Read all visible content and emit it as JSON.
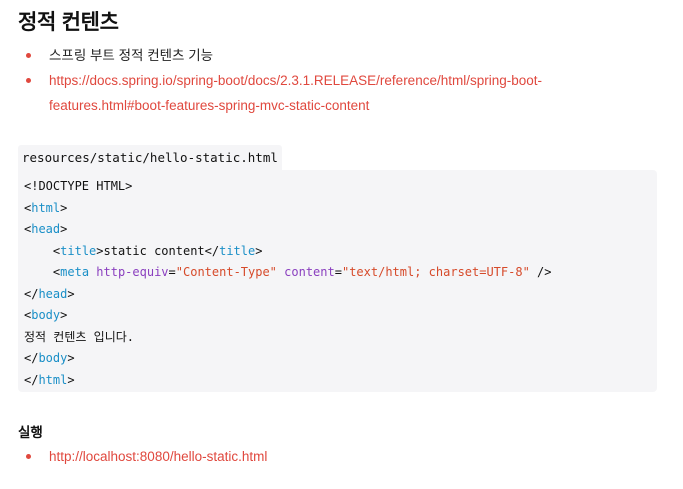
{
  "title": "정적 컨텐츠",
  "intro": {
    "bullet1": "스프링 부트 정적 컨텐츠 기능",
    "link_line1": "https://docs.spring.io/spring-boot/docs/2.3.1.RELEASE/reference/html/spring-boot-",
    "link_line2": "features.html#boot-features-spring-mvc-static-content"
  },
  "code": {
    "filename": "resources/static/hello-static.html",
    "doctype": "<!DOCTYPE HTML>",
    "lt": "<",
    "lt_close": "</",
    "gt": ">",
    "html_tag": "html",
    "head_tag": "head",
    "title_tag": "title",
    "title_text": "static content",
    "meta_tag": "meta",
    "attr_http_equiv": "http-equiv",
    "eq": "=",
    "val_content_type": "\"Content-Type\"",
    "attr_content": "content",
    "val_charset": "\"text/html; charset=UTF-8\"",
    "self_close": " />",
    "body_tag": "body",
    "body_text": "정적 컨텐츠 입니다."
  },
  "run_section": {
    "heading": "실행",
    "link": "http://localhost:8080/hello-static.html"
  },
  "colors": {
    "accent": "#e0483e",
    "tag": "#1a8fc7",
    "attribute": "#8a3fbf",
    "string": "#d64a2a",
    "code_background": "#f5f5f7"
  }
}
